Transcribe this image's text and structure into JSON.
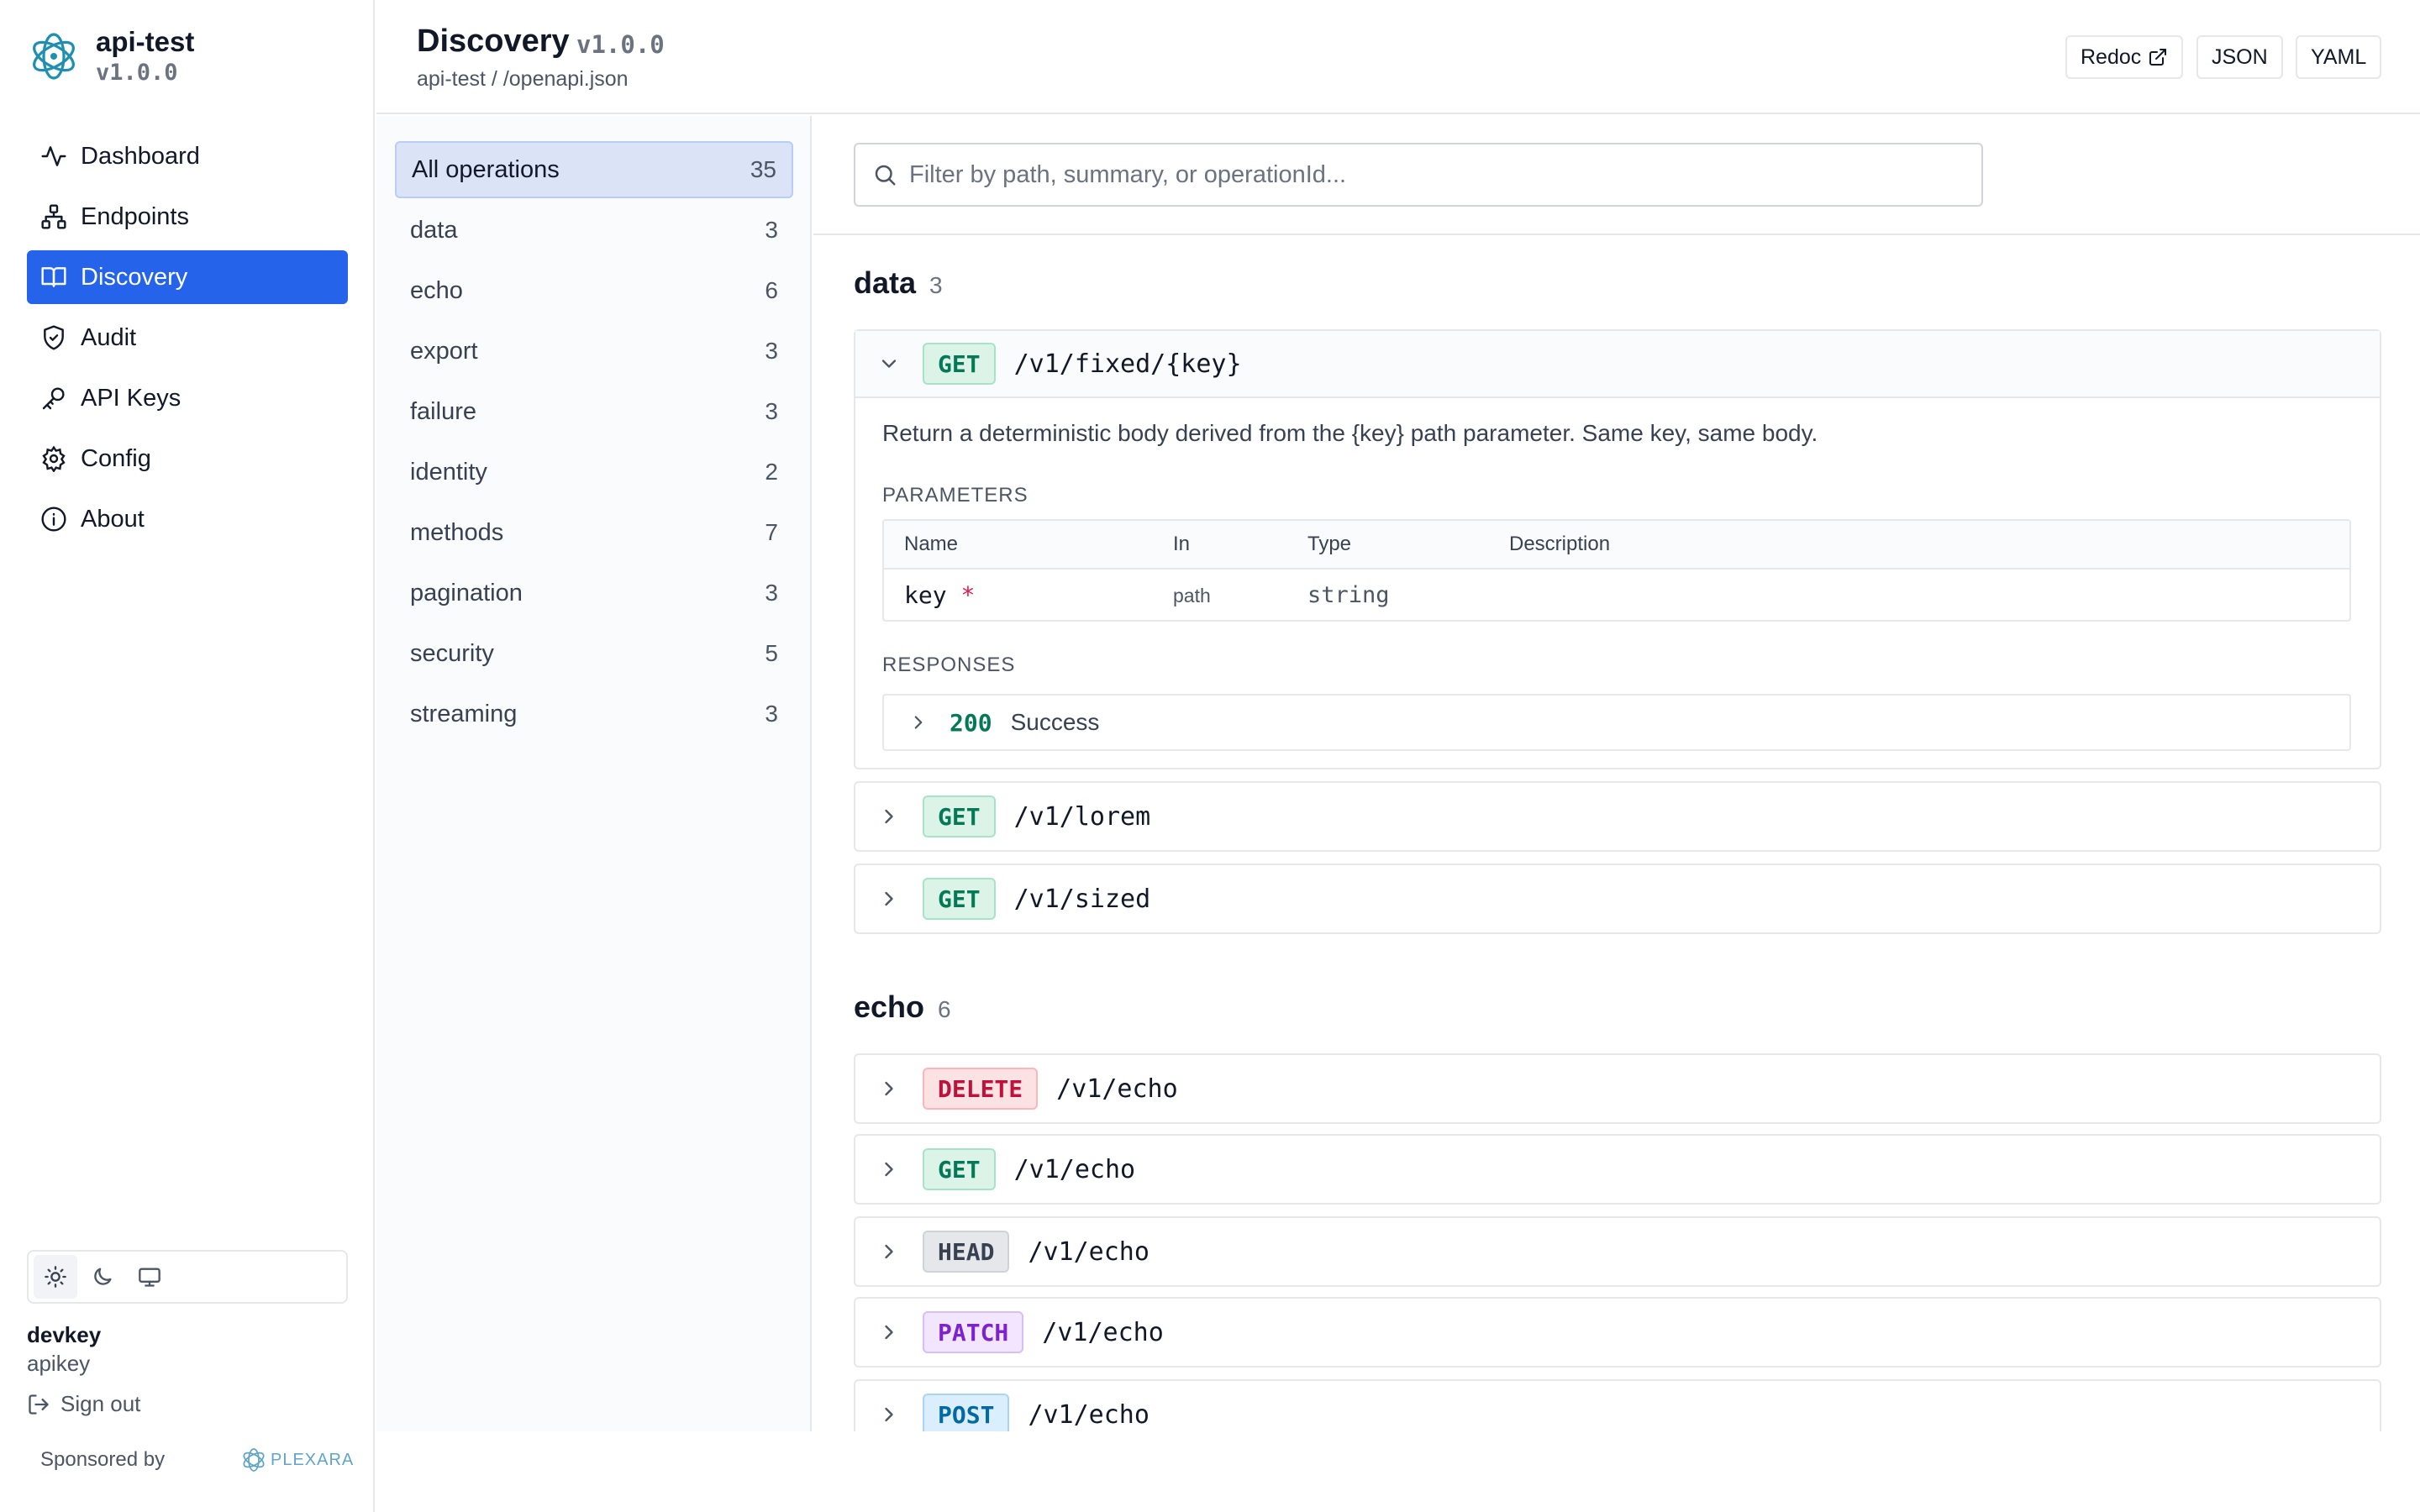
{
  "brand": {
    "name": "api-test",
    "version": "v1.0.0"
  },
  "nav": [
    {
      "label": "Dashboard",
      "icon": "activity-icon"
    },
    {
      "label": "Endpoints",
      "icon": "sitemap-icon"
    },
    {
      "label": "Discovery",
      "icon": "book-icon",
      "active": true
    },
    {
      "label": "Audit",
      "icon": "shield-check-icon"
    },
    {
      "label": "API Keys",
      "icon": "key-icon"
    },
    {
      "label": "Config",
      "icon": "gear-icon"
    },
    {
      "label": "About",
      "icon": "info-icon"
    }
  ],
  "theme": {
    "options": [
      "light",
      "dark",
      "system"
    ],
    "selected": "light"
  },
  "user": {
    "name": "devkey",
    "role": "apikey",
    "signout": "Sign out"
  },
  "sponsor": {
    "label": "Sponsored by",
    "logo_text": "PLEXARA"
  },
  "header": {
    "title": "Discovery",
    "version": "v1.0.0",
    "breadcrumb": "api-test / /openapi.json",
    "buttons": {
      "redoc": "Redoc",
      "json": "JSON",
      "yaml": "YAML"
    }
  },
  "tags": [
    {
      "label": "All operations",
      "count": "35",
      "active": true
    },
    {
      "label": "data",
      "count": "3"
    },
    {
      "label": "echo",
      "count": "6"
    },
    {
      "label": "export",
      "count": "3"
    },
    {
      "label": "failure",
      "count": "3"
    },
    {
      "label": "identity",
      "count": "2"
    },
    {
      "label": "methods",
      "count": "7"
    },
    {
      "label": "pagination",
      "count": "3"
    },
    {
      "label": "security",
      "count": "5"
    },
    {
      "label": "streaming",
      "count": "3"
    }
  ],
  "filter": {
    "placeholder": "Filter by path, summary, or operationId..."
  },
  "sections": {
    "data": {
      "title": "data",
      "count": "3",
      "ops": [
        {
          "method": "GET",
          "path": "/v1/fixed/{key}",
          "expanded": true,
          "description": "Return a deterministic body derived from the {key} path parameter. Same key, same body.",
          "parameters_label": "PARAMETERS",
          "param_headers": {
            "name": "Name",
            "in": "In",
            "type": "Type",
            "description": "Description"
          },
          "params": [
            {
              "name": "key",
              "required": "*",
              "in": "path",
              "type": "string",
              "description": ""
            }
          ],
          "responses_label": "RESPONSES",
          "responses": [
            {
              "code": "200",
              "text": "Success"
            }
          ]
        },
        {
          "method": "GET",
          "path": "/v1/lorem"
        },
        {
          "method": "GET",
          "path": "/v1/sized"
        }
      ]
    },
    "echo": {
      "title": "echo",
      "count": "6",
      "ops": [
        {
          "method": "DELETE",
          "path": "/v1/echo"
        },
        {
          "method": "GET",
          "path": "/v1/echo"
        },
        {
          "method": "HEAD",
          "path": "/v1/echo"
        },
        {
          "method": "PATCH",
          "path": "/v1/echo"
        },
        {
          "method": "POST",
          "path": "/v1/echo"
        }
      ]
    }
  }
}
